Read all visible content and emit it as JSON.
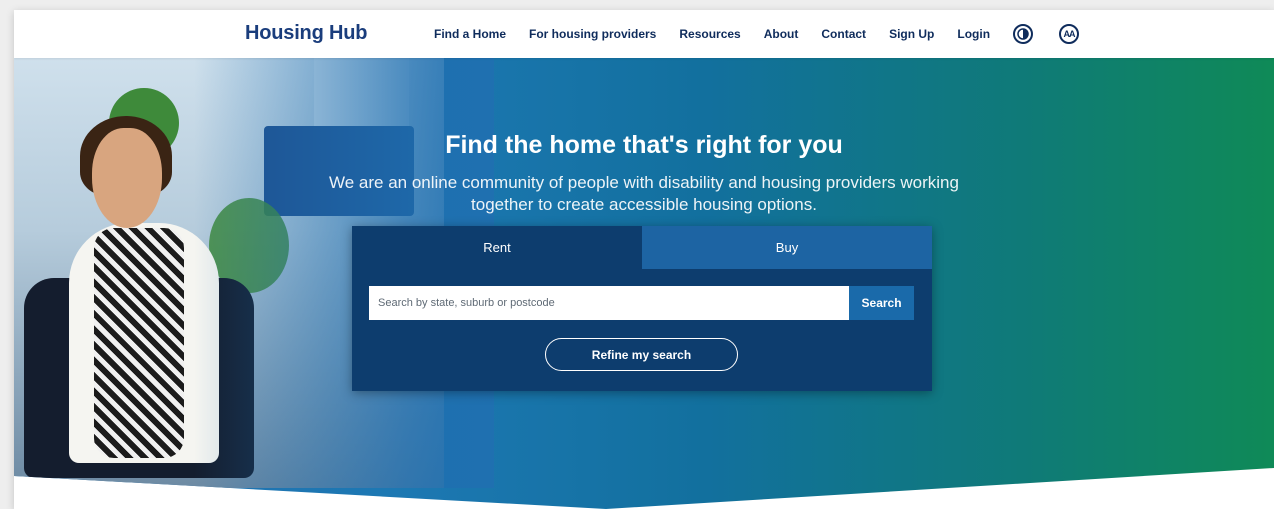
{
  "header": {
    "logo": "Housing Hub",
    "nav": [
      {
        "label": "Find a Home"
      },
      {
        "label": "For housing providers"
      },
      {
        "label": "Resources"
      },
      {
        "label": "About"
      },
      {
        "label": "Contact"
      },
      {
        "label": "Sign Up"
      },
      {
        "label": "Login"
      }
    ],
    "icons": [
      "contrast-icon",
      "text-size-icon"
    ],
    "text_size_glyph": "AA"
  },
  "hero": {
    "title": "Find the home that's right for you",
    "subtitle": "We are an online community of people with disability and housing providers working together to create accessible housing options."
  },
  "search": {
    "tabs": [
      {
        "label": "Rent",
        "active": true
      },
      {
        "label": "Buy",
        "active": false
      }
    ],
    "placeholder": "Search by state, suburb or postcode",
    "button_label": "Search",
    "refine_label": "Refine my search"
  },
  "colors": {
    "brand": "#1a3d7c",
    "card": "#0d3d6e",
    "tab_inactive": "#1d64a3",
    "search_button": "#1a6aaa",
    "gradient_end": "#0f8a57"
  }
}
